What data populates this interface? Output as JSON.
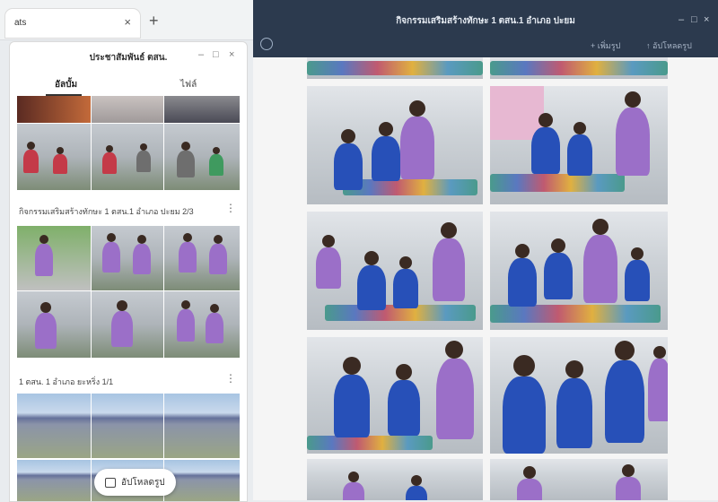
{
  "browser": {
    "tab_title": "ats",
    "tab_close": "×",
    "new_tab": "+"
  },
  "album": {
    "title": "ประชาสัมพันธ์ ตสน.",
    "window_controls": [
      "–",
      "□",
      "×"
    ],
    "tabs": [
      {
        "label": "อัลบั้ม",
        "active": true
      },
      {
        "label": "ไฟล์",
        "active": false
      }
    ],
    "sections": [
      {
        "title": "กิจกรรมเสริมสร้างทักษะ 1 ตสน.1 อำเภอ ปะยม 2/3",
        "menu": "⋮"
      },
      {
        "title": "1 ตสน. 1 อำเภอ ยะหริ่ง 1/1",
        "menu": "⋮"
      }
    ],
    "floating_button": "อัปโหลดรูป"
  },
  "viewer": {
    "title": "กิจกรรมเสริมสร้างทักษะ 1 ตสน.1 อำเภอ ปะยม",
    "window_controls": [
      "–",
      "□",
      "×"
    ],
    "actions": [
      {
        "label": "+ เพิ่มรูป"
      },
      {
        "label": "↑ อัปโหลดรูป"
      }
    ]
  },
  "colors": {
    "viewer_header": "#2c3a4e",
    "shirt_purple": "#9b6fc8",
    "shirt_blue": "#2750b8"
  }
}
